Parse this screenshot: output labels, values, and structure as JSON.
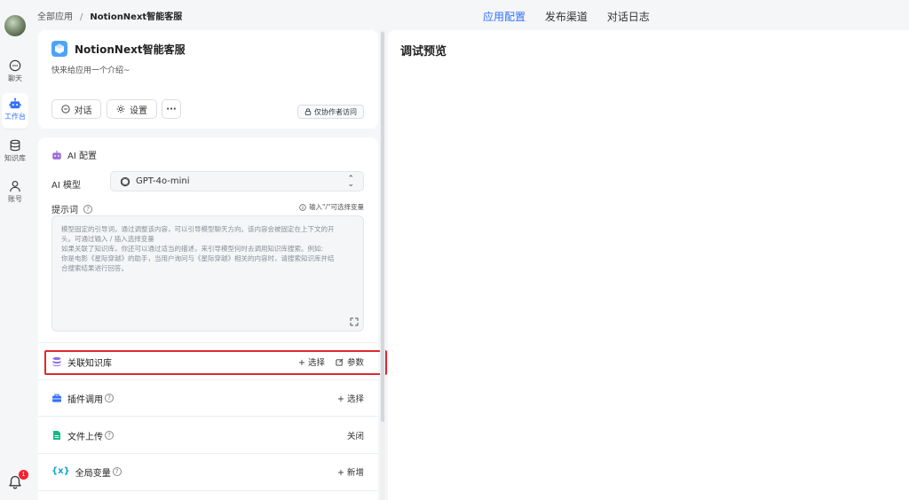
{
  "breadcrumb": {
    "root": "全部应用",
    "separator": "/",
    "current": "NotionNext智能客服"
  },
  "tabs": [
    {
      "label": "应用配置",
      "active": true
    },
    {
      "label": "发布渠道",
      "active": false
    },
    {
      "label": "对话日志",
      "active": false
    }
  ],
  "sidebar": {
    "items": [
      {
        "label": "聊天",
        "icon": "chat-icon",
        "active": false
      },
      {
        "label": "工作台",
        "icon": "robot-icon",
        "active": true
      },
      {
        "label": "知识库",
        "icon": "database-icon",
        "active": false
      },
      {
        "label": "账号",
        "icon": "user-icon",
        "active": false
      }
    ],
    "notification_count": "1"
  },
  "app": {
    "name": "NotionNext智能客服",
    "description": "快来给应用一个介绍~",
    "chat_label": "对话",
    "settings_label": "设置",
    "more_label": "···",
    "collab_label": "仅协作者访问"
  },
  "config": {
    "ai_section_title": "AI 配置",
    "model_label": "AI 模型",
    "model_value": "GPT-4o-mini",
    "prompt_label": "提示词",
    "prompt_hint": "输入\"/\"可选择变量",
    "prompt_placeholder_lines": [
      "模型固定的引导词，通过调整该内容，可以引导模型聊天方向。该内容会被固定在上下文的开",
      "头。可通过输入 / 插入选择变量",
      "如果关联了知识库，你还可以通过适当的描述，来引导模型何时去调用知识库搜索。例如:",
      "你是电影《星际穿越》的助手，当用户询问与《星际穿越》相关的内容时，请搜索知识库并结",
      "合搜索结果进行回答。"
    ],
    "knowledge": {
      "label": "关联知识库",
      "select": "+ 选择",
      "params": "参数"
    },
    "plugin": {
      "label": "插件调用",
      "select": "+ 选择"
    },
    "file_upload": {
      "label": "文件上传",
      "status": "关闭"
    },
    "global_vars": {
      "label": "全局变量",
      "add": "+ 新增"
    }
  },
  "preview": {
    "title": "调试预览"
  },
  "colors": {
    "accent": "#3370ff",
    "highlight": "#e0272e",
    "badge": "#f5222d"
  }
}
